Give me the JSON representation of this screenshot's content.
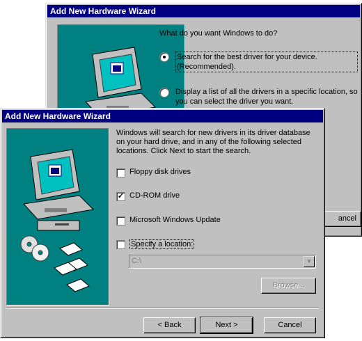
{
  "back_dialog": {
    "title": "Add New Hardware Wizard",
    "question": "What do you want Windows to do?",
    "option1_label": "Search for the best driver for your device. (Recommended).",
    "option2_label": "Display a list of all the drivers in a specific location, so you can select the driver you want.",
    "cancel_label_visible": "ancel"
  },
  "front_dialog": {
    "title": "Add New Hardware Wizard",
    "description": "Windows will search for new drivers in its driver database on your hard drive, and in any of the following selected locations. Click Next to start the search.",
    "options": [
      {
        "label": "Floppy disk drives",
        "checked": false
      },
      {
        "label": "CD-ROM drive",
        "checked": true
      },
      {
        "label": "Microsoft Windows Update",
        "checked": false
      },
      {
        "label": "Specify a location:",
        "checked": false
      }
    ],
    "location_value": "C:\\",
    "browse_label": "Browse...",
    "back_label": "< Back",
    "next_label": "Next >",
    "cancel_label": "Cancel"
  }
}
